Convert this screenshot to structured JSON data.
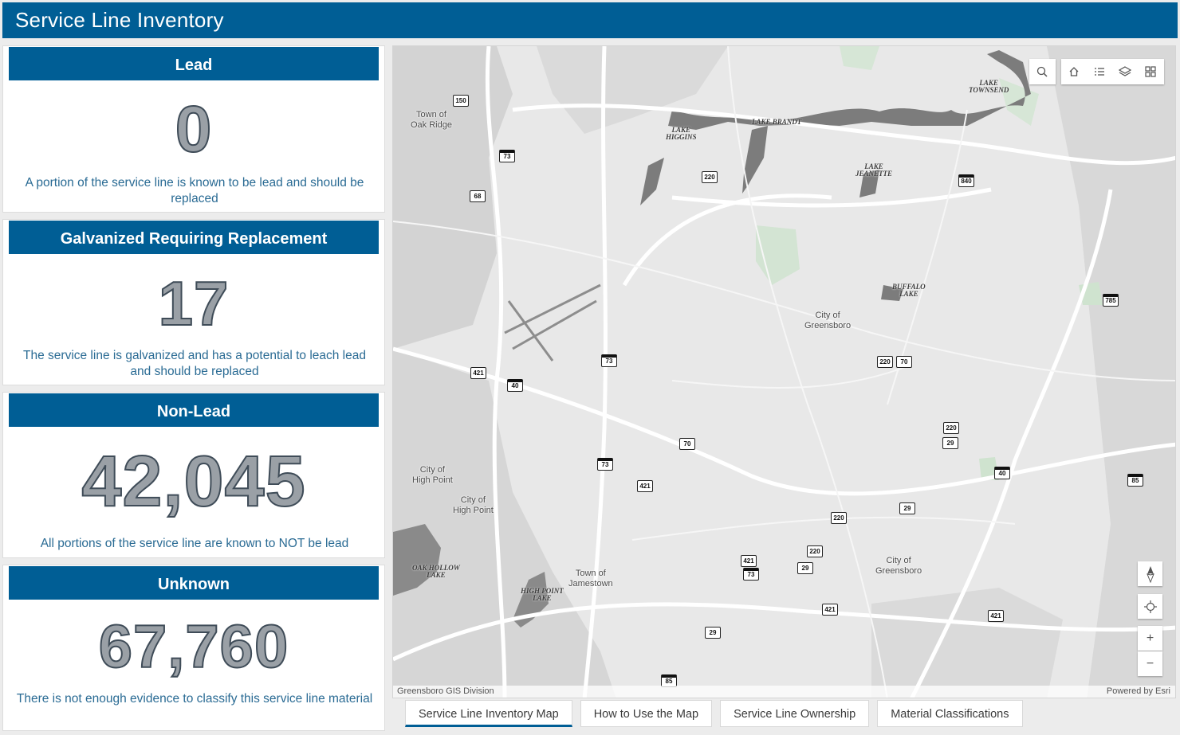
{
  "header": {
    "title": "Service Line Inventory"
  },
  "cards": [
    {
      "title": "Lead",
      "value": "0",
      "description": "A portion of the service line is known to be lead and should be replaced"
    },
    {
      "title": "Galvanized Requiring Replacement",
      "value": "17",
      "description": "The service line is galvanized and has a potential to leach lead and should be replaced"
    },
    {
      "title": "Non-Lead",
      "value": "42,045",
      "description": "All portions of the service line are known to NOT be lead"
    },
    {
      "title": "Unknown",
      "value": "67,760",
      "description": "There is not enough evidence to classify this service line material"
    }
  ],
  "map": {
    "place_labels": {
      "oak_ridge": "Town of\nOak Ridge",
      "greensboro_center": "City of\nGreensboro",
      "greensboro_se": "City of\nGreensboro",
      "high_point_1": "City of\nHigh Point",
      "high_point_2": "City of\nHigh Point",
      "jamestown": "Town of\nJamestown"
    },
    "lake_labels": {
      "townsend": "LAKE\nTOWNSEND",
      "higgins": "LAKE\nHIGGINS",
      "brandt": "LAKE BRANDT",
      "jeanette": "LAKE\nJEANETTE",
      "buffalo": "BUFFALO\nLAKE",
      "oak_hollow": "OAK HOLLOW\nLAKE",
      "high_point_lake": "HIGH POINT\nLAKE"
    },
    "shields": {
      "s150": "150",
      "s73a": "73",
      "s68": "68",
      "s220a": "220",
      "s840": "840",
      "s785": "785",
      "s73b": "73",
      "s421a": "421",
      "s40a": "40",
      "s220b": "220",
      "s70a": "70",
      "s70b": "70",
      "s220c": "220",
      "s29a": "29",
      "s73c": "73",
      "s421b": "421",
      "s40b": "40",
      "s85a": "85",
      "s29b": "29",
      "s220d": "220",
      "s220e": "220",
      "s421c": "421",
      "s29c": "29",
      "s73d": "73",
      "s421d": "421",
      "s421e": "421",
      "s29d": "29",
      "s85b": "85"
    },
    "attribution_left": "Greensboro GIS Division",
    "attribution_right": "Powered by Esri",
    "tools": [
      "search-icon",
      "home-icon",
      "legend-icon",
      "layers-icon",
      "basemap-gallery-icon"
    ],
    "zoom_in": "+",
    "zoom_out": "−"
  },
  "tabs": [
    {
      "label": "Service Line Inventory Map",
      "active": true
    },
    {
      "label": "How to Use the Map",
      "active": false
    },
    {
      "label": "Service Line Ownership",
      "active": false
    },
    {
      "label": "Material Classifications",
      "active": false
    }
  ],
  "colors": {
    "header": "#005e95",
    "value_fill": "#9aa0a6",
    "description": "#2a6b94"
  }
}
